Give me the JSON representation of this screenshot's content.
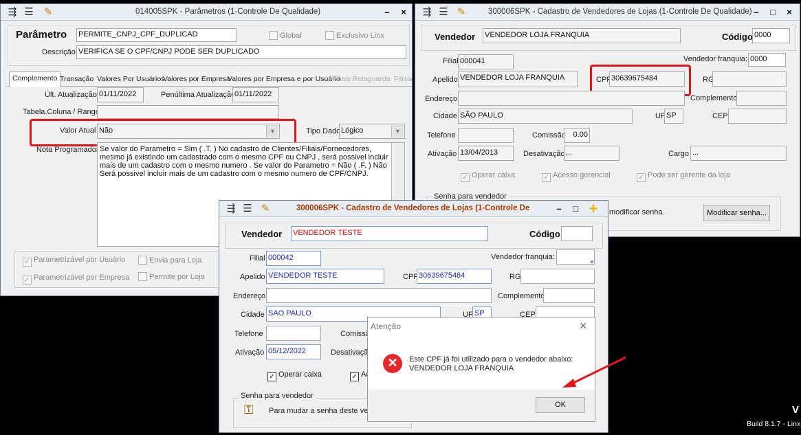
{
  "colors": {
    "highlight": "#e3141b",
    "field_value_blue": "#1b28c8",
    "field_value_red": "#e00000",
    "error": "#e32a2a"
  },
  "win_param": {
    "title": "014005SPK - Parâmetros (1-Controle De Qualidade)",
    "parametro_label": "Parâmetro",
    "parametro_value": "PERMITE_CNPJ_CPF_DUPLICAD",
    "global_label": "Global",
    "exclusivo_label": "Exclusivo Linx",
    "descricao_label": "Descrição",
    "descricao_value": "VERIFICA SE O CPF/CNPJ PODE SER DUPLICADO",
    "tabs": [
      "Complemento",
      "Transação",
      "Valores Por Usuários",
      "Valores por Empresa",
      "Valores por Empresa e por Usuário",
      "Filiais Retaguarda",
      "Filiais"
    ],
    "ult_atual_label": "Últ. Atualização",
    "ult_atual_value": "01/11/2022",
    "penult_label": "Penúltima Atualização",
    "penult_value": "01/11/2022",
    "tabela_label": "Tabela.Coluna / Range",
    "valor_label": "Valor Atual",
    "valor_value": "Não",
    "tipo_label": "Tipo Dado",
    "tipo_value": "Lógico",
    "nota_label": "Nota Programador",
    "nota_value": "Se valor do Parametro = Sim ( .T. )  No cadastro de Clientes/Filiais/Fornecedores, mesmo já existindo um cadastrado com o mesmo CPF ou CNPJ , será possivel incluir mais de um cadastro com o mesmo numero .    Se valor do Parametro = Não ( .F. )  Não Será possivel incluir mais de um cadastro com o mesmo numero de CPF/CNPJ.",
    "chk_param_usuario": "Parametrizável por Usuário",
    "chk_envia_loja": "Envia para Loja",
    "chk_param_empresa": "Parametrizável por Empresa",
    "chk_permite_loja": "Permite por Loja"
  },
  "win_vend1": {
    "title": "300006SPK - Cadastro de Vendedores de Lojas (1-Controle De Qualidade)",
    "vendedor_label": "Vendedor",
    "vendedor_value": "VENDEDOR LOJA FRANQUIA",
    "codigo_label": "Código",
    "codigo_value": "0000",
    "filial_label": "Filial",
    "filial_value": "000041",
    "vend_franquia_label": "Vendedor franquia:",
    "vend_franquia_value": "0000",
    "apelido_label": "Apelido",
    "apelido_value": "VENDEDOR LOJA FRANQUIA",
    "cpf_label": "CPF",
    "cpf_value": "30639675484",
    "rg_label": "RG",
    "endereco_label": "Endereço",
    "complemento_label": "Complemento",
    "cidade_label": "Cidade",
    "cidade_value": "SÃO PAULO",
    "uf_label": "UF",
    "uf_value": "SP",
    "cep_label": "CEP",
    "telefone_label": "Telefone",
    "comissao_label": "Comissão",
    "comissao_value": "0.00",
    "ativacao_label": "Ativação",
    "ativacao_value": "13/04/2013",
    "desativacao_label": "Desativação",
    "desativacao_value": "...",
    "cargo_label": "Cargo",
    "cargo_value": "...",
    "chk_operar": "Operar caixa",
    "chk_acesso": "Acesso gerencial",
    "chk_gerente": "Pode ser gerente da loja",
    "senha_group": "Senha para vendedor",
    "senha_text": "modificar senha.",
    "modificar_btn": "Modificar senha..."
  },
  "win_vend2": {
    "title": "300006SPK - Cadastro de Vendedores de Lojas (1-Controle De Q",
    "vendedor_label": "Vendedor",
    "vendedor_value": "VENDEDOR TESTE",
    "codigo_label": "Código",
    "filial_label": "Filial",
    "filial_value": "000042",
    "vend_franquia_label": "Vendedor franquia:",
    "apelido_label": "Apelido",
    "apelido_value": "VENDEDOR TESTE",
    "cpf_label": "CPF",
    "cpf_value": "30639675484",
    "rg_label": "RG",
    "endereco_label": "Endereço",
    "complemento_label": "Complemento",
    "cidade_label": "Cidade",
    "cidade_value": "SAO PAULO",
    "uf_label": "UF",
    "uf_value": "SP",
    "cep_label": "CEP",
    "telefone_label": "Telefone",
    "comissao_label": "Comissã",
    "ativacao_label": "Ativação",
    "ativacao_value": "05/12/2022",
    "desativacao_label": "Desativaçã",
    "chk_operar": "Operar caixa",
    "chk_a": "Ac",
    "senha_group": "Senha para vendedor",
    "senha_text": "Para mudar a senha deste vend"
  },
  "dialog": {
    "title": "Atenção",
    "message_line1": "Este CPF já foi utilizado para o vendedor abaixo:",
    "message_line2": "VENDEDOR LOJA FRANQUIA",
    "ok_label": "OK"
  },
  "status": {
    "letter": "V",
    "build": "Build 8.1.7 - Linx"
  }
}
